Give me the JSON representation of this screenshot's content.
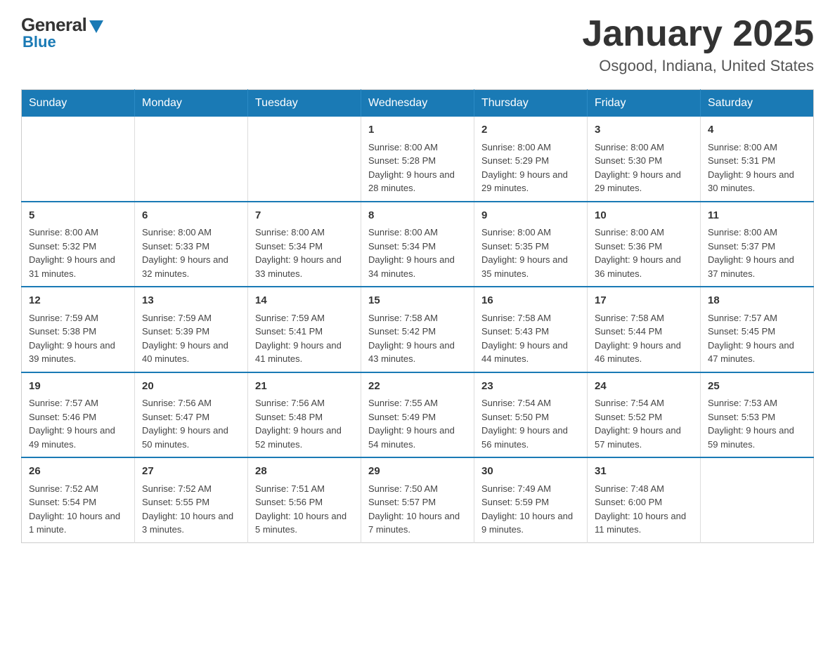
{
  "header": {
    "logo_general": "General",
    "logo_blue": "Blue",
    "title": "January 2025",
    "subtitle": "Osgood, Indiana, United States"
  },
  "days_of_week": [
    "Sunday",
    "Monday",
    "Tuesday",
    "Wednesday",
    "Thursday",
    "Friday",
    "Saturday"
  ],
  "weeks": [
    [
      {
        "day": "",
        "info": ""
      },
      {
        "day": "",
        "info": ""
      },
      {
        "day": "",
        "info": ""
      },
      {
        "day": "1",
        "info": "Sunrise: 8:00 AM\nSunset: 5:28 PM\nDaylight: 9 hours and 28 minutes."
      },
      {
        "day": "2",
        "info": "Sunrise: 8:00 AM\nSunset: 5:29 PM\nDaylight: 9 hours and 29 minutes."
      },
      {
        "day": "3",
        "info": "Sunrise: 8:00 AM\nSunset: 5:30 PM\nDaylight: 9 hours and 29 minutes."
      },
      {
        "day": "4",
        "info": "Sunrise: 8:00 AM\nSunset: 5:31 PM\nDaylight: 9 hours and 30 minutes."
      }
    ],
    [
      {
        "day": "5",
        "info": "Sunrise: 8:00 AM\nSunset: 5:32 PM\nDaylight: 9 hours and 31 minutes."
      },
      {
        "day": "6",
        "info": "Sunrise: 8:00 AM\nSunset: 5:33 PM\nDaylight: 9 hours and 32 minutes."
      },
      {
        "day": "7",
        "info": "Sunrise: 8:00 AM\nSunset: 5:34 PM\nDaylight: 9 hours and 33 minutes."
      },
      {
        "day": "8",
        "info": "Sunrise: 8:00 AM\nSunset: 5:34 PM\nDaylight: 9 hours and 34 minutes."
      },
      {
        "day": "9",
        "info": "Sunrise: 8:00 AM\nSunset: 5:35 PM\nDaylight: 9 hours and 35 minutes."
      },
      {
        "day": "10",
        "info": "Sunrise: 8:00 AM\nSunset: 5:36 PM\nDaylight: 9 hours and 36 minutes."
      },
      {
        "day": "11",
        "info": "Sunrise: 8:00 AM\nSunset: 5:37 PM\nDaylight: 9 hours and 37 minutes."
      }
    ],
    [
      {
        "day": "12",
        "info": "Sunrise: 7:59 AM\nSunset: 5:38 PM\nDaylight: 9 hours and 39 minutes."
      },
      {
        "day": "13",
        "info": "Sunrise: 7:59 AM\nSunset: 5:39 PM\nDaylight: 9 hours and 40 minutes."
      },
      {
        "day": "14",
        "info": "Sunrise: 7:59 AM\nSunset: 5:41 PM\nDaylight: 9 hours and 41 minutes."
      },
      {
        "day": "15",
        "info": "Sunrise: 7:58 AM\nSunset: 5:42 PM\nDaylight: 9 hours and 43 minutes."
      },
      {
        "day": "16",
        "info": "Sunrise: 7:58 AM\nSunset: 5:43 PM\nDaylight: 9 hours and 44 minutes."
      },
      {
        "day": "17",
        "info": "Sunrise: 7:58 AM\nSunset: 5:44 PM\nDaylight: 9 hours and 46 minutes."
      },
      {
        "day": "18",
        "info": "Sunrise: 7:57 AM\nSunset: 5:45 PM\nDaylight: 9 hours and 47 minutes."
      }
    ],
    [
      {
        "day": "19",
        "info": "Sunrise: 7:57 AM\nSunset: 5:46 PM\nDaylight: 9 hours and 49 minutes."
      },
      {
        "day": "20",
        "info": "Sunrise: 7:56 AM\nSunset: 5:47 PM\nDaylight: 9 hours and 50 minutes."
      },
      {
        "day": "21",
        "info": "Sunrise: 7:56 AM\nSunset: 5:48 PM\nDaylight: 9 hours and 52 minutes."
      },
      {
        "day": "22",
        "info": "Sunrise: 7:55 AM\nSunset: 5:49 PM\nDaylight: 9 hours and 54 minutes."
      },
      {
        "day": "23",
        "info": "Sunrise: 7:54 AM\nSunset: 5:50 PM\nDaylight: 9 hours and 56 minutes."
      },
      {
        "day": "24",
        "info": "Sunrise: 7:54 AM\nSunset: 5:52 PM\nDaylight: 9 hours and 57 minutes."
      },
      {
        "day": "25",
        "info": "Sunrise: 7:53 AM\nSunset: 5:53 PM\nDaylight: 9 hours and 59 minutes."
      }
    ],
    [
      {
        "day": "26",
        "info": "Sunrise: 7:52 AM\nSunset: 5:54 PM\nDaylight: 10 hours and 1 minute."
      },
      {
        "day": "27",
        "info": "Sunrise: 7:52 AM\nSunset: 5:55 PM\nDaylight: 10 hours and 3 minutes."
      },
      {
        "day": "28",
        "info": "Sunrise: 7:51 AM\nSunset: 5:56 PM\nDaylight: 10 hours and 5 minutes."
      },
      {
        "day": "29",
        "info": "Sunrise: 7:50 AM\nSunset: 5:57 PM\nDaylight: 10 hours and 7 minutes."
      },
      {
        "day": "30",
        "info": "Sunrise: 7:49 AM\nSunset: 5:59 PM\nDaylight: 10 hours and 9 minutes."
      },
      {
        "day": "31",
        "info": "Sunrise: 7:48 AM\nSunset: 6:00 PM\nDaylight: 10 hours and 11 minutes."
      },
      {
        "day": "",
        "info": ""
      }
    ]
  ]
}
